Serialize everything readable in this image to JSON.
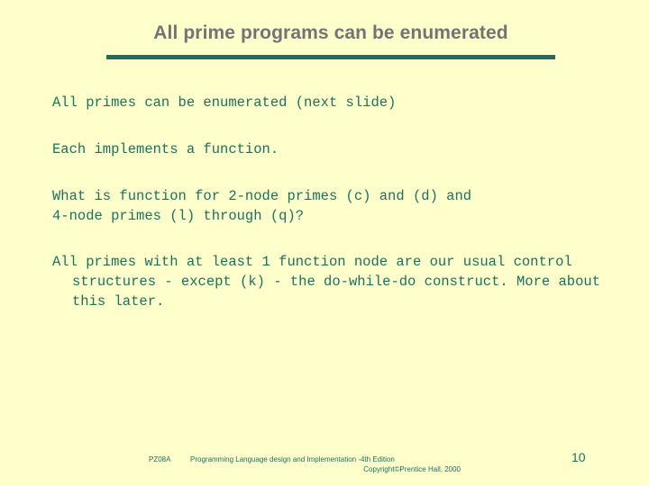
{
  "slide": {
    "title": "All prime programs can be enumerated",
    "page_number": "10",
    "colors": {
      "background": "#ffffcc",
      "title_text": "#737373",
      "body_text": "#1d6f5e",
      "rule": "#1d6f5e",
      "footer_text": "#1d6f5e"
    }
  },
  "body": {
    "paragraphs": [
      "All primes can be enumerated (next slide)",
      "Each implements a function.",
      "What is function for 2-node primes (c) and (d) and\n4-node primes (l) through (q)?",
      "All primes with at least 1 function node are our usual control structures - except (k) - the do-while-do construct. More about this later."
    ]
  },
  "footer": {
    "code": "PZ08A",
    "line1": "Programming Language design and Implementation -4th Edition",
    "line2": "Copyright©Prentice Hall, 2000"
  }
}
